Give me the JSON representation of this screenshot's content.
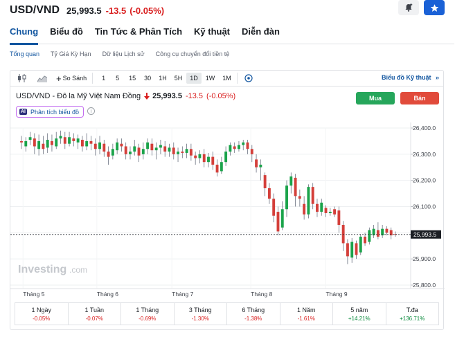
{
  "header": {
    "symbol": "USD/VND",
    "price": "25,993.5",
    "change": "-13.5",
    "change_pct": "(-0.05%)"
  },
  "main_tabs": [
    "Chung",
    "Biểu đồ",
    "Tin Tức & Phân Tích",
    "Kỹ thuật",
    "Diễn đàn"
  ],
  "sub_tabs": [
    "Tổng quan",
    "Tỷ Giá Kỳ Hạn",
    "Dữ liệu Lịch sử",
    "Công cụ chuyển đổi tiền tệ"
  ],
  "toolbar": {
    "compare": "So Sánh",
    "periods": [
      "1",
      "5",
      "15",
      "30",
      "1H",
      "5H",
      "1D",
      "1W",
      "1M"
    ],
    "active_period": "1D",
    "technical_chart": "Biểu đồ Kỹ thuật"
  },
  "chart_header": {
    "name": "USD/VND - Đô la Mỹ Việt Nam Đồng",
    "price": "25,993.5",
    "change": "-13.5",
    "change_pct": "(-0.05%)",
    "buy": "Mua",
    "sell": "Bán",
    "ai_badge": "AI",
    "ai_label": "Phân tích biểu đồ",
    "info": "i"
  },
  "watermark": {
    "brand": "Investing",
    "suffix": ".com"
  },
  "chart_data": {
    "type": "candlestick",
    "yticks": [
      26400,
      26300,
      26200,
      26100,
      26000,
      25900,
      25800
    ],
    "ytick_labels": [
      "26,400.0",
      "26,300.0",
      "26,200.0",
      "26,100.0",
      "26,000.0",
      "25,900.0",
      "25,800.0"
    ],
    "ylim": [
      25800,
      26400
    ],
    "xticks": [
      "Tháng 5",
      "Tháng 6",
      "Tháng 7",
      "Tháng 8",
      "Tháng 9"
    ],
    "last_price": 25993.5,
    "last_price_label": "25,993.5",
    "colors": {
      "up": "#1aa34a",
      "down": "#d43f3a",
      "wick": "#6b7280"
    },
    "candles": [
      {
        "o": 26350,
        "c": 26345,
        "h": 26370,
        "l": 26320
      },
      {
        "o": 26330,
        "c": 26350,
        "h": 26365,
        "l": 26310
      },
      {
        "o": 26355,
        "c": 26365,
        "h": 26385,
        "l": 26335
      },
      {
        "o": 26360,
        "c": 26330,
        "h": 26380,
        "l": 26300
      },
      {
        "o": 26320,
        "c": 26350,
        "h": 26375,
        "l": 26295
      },
      {
        "o": 26340,
        "c": 26320,
        "h": 26370,
        "l": 26300
      },
      {
        "o": 26325,
        "c": 26355,
        "h": 26380,
        "l": 26305
      },
      {
        "o": 26350,
        "c": 26335,
        "h": 26375,
        "l": 26310
      },
      {
        "o": 26330,
        "c": 26360,
        "h": 26385,
        "l": 26320
      },
      {
        "o": 26360,
        "c": 26370,
        "h": 26390,
        "l": 26340
      },
      {
        "o": 26365,
        "c": 26340,
        "h": 26385,
        "l": 26320
      },
      {
        "o": 26340,
        "c": 26365,
        "h": 26385,
        "l": 26330
      },
      {
        "o": 26360,
        "c": 26350,
        "h": 26380,
        "l": 26330
      },
      {
        "o": 26345,
        "c": 26360,
        "h": 26375,
        "l": 26320
      },
      {
        "o": 26355,
        "c": 26330,
        "h": 26370,
        "l": 26310
      },
      {
        "o": 26330,
        "c": 26350,
        "h": 26380,
        "l": 26315
      },
      {
        "o": 26350,
        "c": 26340,
        "h": 26370,
        "l": 26315
      },
      {
        "o": 26340,
        "c": 26320,
        "h": 26360,
        "l": 26295
      },
      {
        "o": 26320,
        "c": 26345,
        "h": 26370,
        "l": 26300
      },
      {
        "o": 26340,
        "c": 26310,
        "h": 26355,
        "l": 26290
      },
      {
        "o": 26310,
        "c": 26290,
        "h": 26330,
        "l": 26260
      },
      {
        "o": 26295,
        "c": 26320,
        "h": 26340,
        "l": 26280
      },
      {
        "o": 26315,
        "c": 26345,
        "h": 26360,
        "l": 26300
      },
      {
        "o": 26340,
        "c": 26330,
        "h": 26360,
        "l": 26310
      },
      {
        "o": 26330,
        "c": 26300,
        "h": 26345,
        "l": 26280
      },
      {
        "o": 26300,
        "c": 26310,
        "h": 26330,
        "l": 26280
      },
      {
        "o": 26310,
        "c": 26330,
        "h": 26355,
        "l": 26295
      },
      {
        "o": 26325,
        "c": 26295,
        "h": 26340,
        "l": 26270
      },
      {
        "o": 26300,
        "c": 26320,
        "h": 26345,
        "l": 26280
      },
      {
        "o": 26320,
        "c": 26345,
        "h": 26360,
        "l": 26300
      },
      {
        "o": 26340,
        "c": 26315,
        "h": 26360,
        "l": 26295
      },
      {
        "o": 26315,
        "c": 26325,
        "h": 26345,
        "l": 26280
      },
      {
        "o": 26325,
        "c": 26335,
        "h": 26355,
        "l": 26300
      },
      {
        "o": 26330,
        "c": 26310,
        "h": 26350,
        "l": 26290
      },
      {
        "o": 26310,
        "c": 26325,
        "h": 26340,
        "l": 26290
      },
      {
        "o": 26325,
        "c": 26300,
        "h": 26345,
        "l": 26280
      },
      {
        "o": 26300,
        "c": 26310,
        "h": 26325,
        "l": 26270
      },
      {
        "o": 26310,
        "c": 26305,
        "h": 26330,
        "l": 26285
      },
      {
        "o": 26305,
        "c": 26320,
        "h": 26340,
        "l": 26285
      },
      {
        "o": 26320,
        "c": 26295,
        "h": 26340,
        "l": 26275
      },
      {
        "o": 26295,
        "c": 26285,
        "h": 26310,
        "l": 26260
      },
      {
        "o": 26285,
        "c": 26300,
        "h": 26315,
        "l": 26265
      },
      {
        "o": 26300,
        "c": 26270,
        "h": 26320,
        "l": 26250
      },
      {
        "o": 26270,
        "c": 26290,
        "h": 26305,
        "l": 26250
      },
      {
        "o": 26290,
        "c": 26260,
        "h": 26310,
        "l": 26240
      },
      {
        "o": 26260,
        "c": 26230,
        "h": 26280,
        "l": 26215
      },
      {
        "o": 26235,
        "c": 26270,
        "h": 26290,
        "l": 26225
      },
      {
        "o": 26270,
        "c": 26310,
        "h": 26330,
        "l": 26255
      },
      {
        "o": 26310,
        "c": 26335,
        "h": 26345,
        "l": 26295
      },
      {
        "o": 26330,
        "c": 26320,
        "h": 26345,
        "l": 26305
      },
      {
        "o": 26320,
        "c": 26335,
        "h": 26350,
        "l": 26310
      },
      {
        "o": 26335,
        "c": 26345,
        "h": 26355,
        "l": 26315
      },
      {
        "o": 26345,
        "c": 26320,
        "h": 26355,
        "l": 26300
      },
      {
        "o": 26320,
        "c": 26300,
        "h": 26335,
        "l": 26270
      },
      {
        "o": 26280,
        "c": 26250,
        "h": 26300,
        "l": 26230
      },
      {
        "o": 26250,
        "c": 26260,
        "h": 26280,
        "l": 26200
      },
      {
        "o": 26220,
        "c": 26170,
        "h": 26230,
        "l": 26140
      },
      {
        "o": 26170,
        "c": 26130,
        "h": 26190,
        "l": 26110
      },
      {
        "o": 26130,
        "c": 26065,
        "h": 26150,
        "l": 26040
      },
      {
        "o": 26080,
        "c": 26005,
        "h": 26100,
        "l": 25990
      },
      {
        "o": 26020,
        "c": 26090,
        "h": 26120,
        "l": 26010
      },
      {
        "o": 26090,
        "c": 26180,
        "h": 26200,
        "l": 26060
      },
      {
        "o": 26180,
        "c": 26215,
        "h": 26230,
        "l": 26150
      },
      {
        "o": 26210,
        "c": 26140,
        "h": 26225,
        "l": 26100
      },
      {
        "o": 26140,
        "c": 26130,
        "h": 26165,
        "l": 26100
      },
      {
        "o": 26110,
        "c": 26070,
        "h": 26140,
        "l": 26050
      },
      {
        "o": 26070,
        "c": 26175,
        "h": 26185,
        "l": 26055
      },
      {
        "o": 26175,
        "c": 26110,
        "h": 26190,
        "l": 26090
      },
      {
        "o": 26110,
        "c": 26080,
        "h": 26130,
        "l": 26060
      },
      {
        "o": 26080,
        "c": 26115,
        "h": 26130,
        "l": 26065
      },
      {
        "o": 26095,
        "c": 26075,
        "h": 26105,
        "l": 26060
      },
      {
        "o": 26075,
        "c": 26080,
        "h": 26095,
        "l": 26065
      },
      {
        "o": 26090,
        "c": 26070,
        "h": 26100,
        "l": 26060
      },
      {
        "o": 26085,
        "c": 26030,
        "h": 26100,
        "l": 26000
      },
      {
        "o": 26030,
        "c": 25960,
        "h": 26045,
        "l": 25930
      },
      {
        "o": 25960,
        "c": 25910,
        "h": 25975,
        "l": 25880
      },
      {
        "o": 25905,
        "c": 25965,
        "h": 25980,
        "l": 25885
      },
      {
        "o": 25960,
        "c": 25915,
        "h": 25970,
        "l": 25900
      },
      {
        "o": 25925,
        "c": 25985,
        "h": 25995,
        "l": 25915
      },
      {
        "o": 25985,
        "c": 25960,
        "h": 26000,
        "l": 25950
      },
      {
        "o": 25965,
        "c": 26010,
        "h": 26020,
        "l": 25955
      },
      {
        "o": 25990,
        "c": 26015,
        "h": 26030,
        "l": 25980
      },
      {
        "o": 26010,
        "c": 25985,
        "h": 26040,
        "l": 25975
      },
      {
        "o": 25990,
        "c": 26015,
        "h": 26030,
        "l": 25980
      },
      {
        "o": 26015,
        "c": 26000,
        "h": 26025,
        "l": 25990
      },
      {
        "o": 26010,
        "c": 25990,
        "h": 26020,
        "l": 25975
      },
      {
        "o": 25995,
        "c": 25993.5,
        "h": 26005,
        "l": 25985
      }
    ]
  },
  "performance": [
    {
      "label": "1 Ngày",
      "value": "-0.05%",
      "sign": "neg"
    },
    {
      "label": "1 Tuần",
      "value": "-0.07%",
      "sign": "neg"
    },
    {
      "label": "1 Tháng",
      "value": "-0.69%",
      "sign": "neg"
    },
    {
      "label": "3 Tháng",
      "value": "-1.30%",
      "sign": "neg"
    },
    {
      "label": "6 Tháng",
      "value": "-1.38%",
      "sign": "neg"
    },
    {
      "label": "1 Năm",
      "value": "-1.61%",
      "sign": "neg"
    },
    {
      "label": "5 năm",
      "value": "+14.21%",
      "sign": "pos"
    },
    {
      "label": "T.đa",
      "value": "+136.71%",
      "sign": "pos"
    }
  ]
}
